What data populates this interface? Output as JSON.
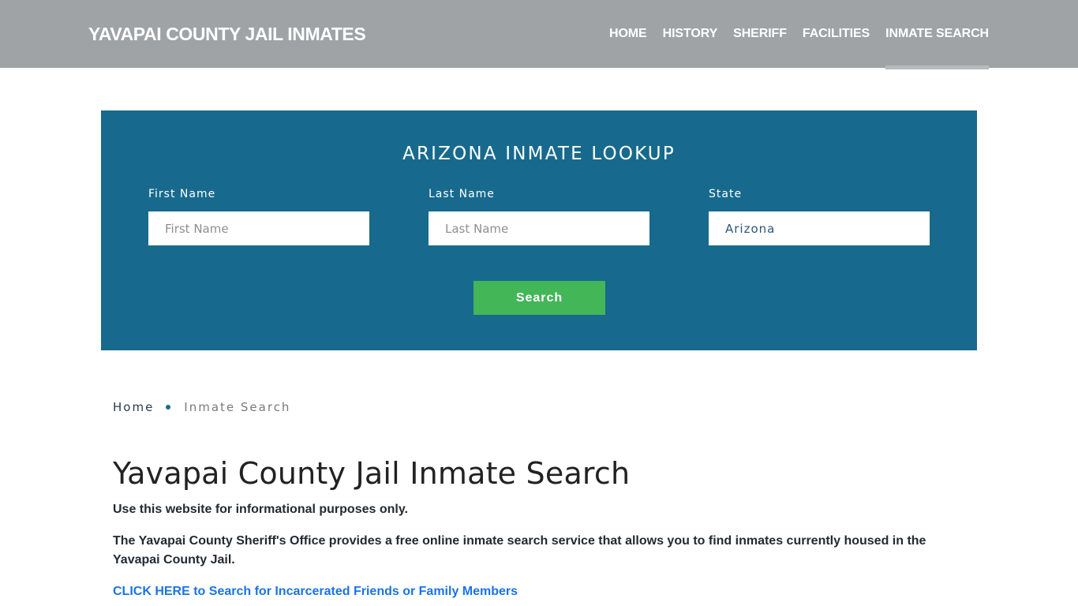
{
  "header": {
    "brand": "YAVAPAI COUNTY JAIL INMATES",
    "nav": [
      {
        "label": "HOME",
        "active": false
      },
      {
        "label": "HISTORY",
        "active": false
      },
      {
        "label": "SHERIFF",
        "active": false
      },
      {
        "label": "FACILITIES",
        "active": false
      },
      {
        "label": "INMATE SEARCH",
        "active": true
      }
    ]
  },
  "lookup": {
    "title": "ARIZONA INMATE LOOKUP",
    "first_name": {
      "label": "First Name",
      "placeholder": "First Name",
      "value": ""
    },
    "last_name": {
      "label": "Last Name",
      "placeholder": "Last Name",
      "value": ""
    },
    "state": {
      "label": "State",
      "value": "Arizona"
    },
    "search_label": "Search"
  },
  "breadcrumb": {
    "home": "Home",
    "current": "Inmate Search"
  },
  "content": {
    "title": "Yavapai County Jail Inmate Search",
    "paragraph_1": "Use this website for informational purposes only.",
    "paragraph_2": "The Yavapai County Sheriff's Office provides a free online inmate search service that allows you to find inmates currently housed in the Yavapai County Jail.",
    "cta_link": "CLICK HERE to Search for Incarcerated Friends or Family Members"
  },
  "colors": {
    "header_bg": "#9fa3a6",
    "panel_bg": "#176a8d",
    "button_bg": "#43b658",
    "link": "#1a73e8",
    "active_underline": "#b9bbbb"
  }
}
